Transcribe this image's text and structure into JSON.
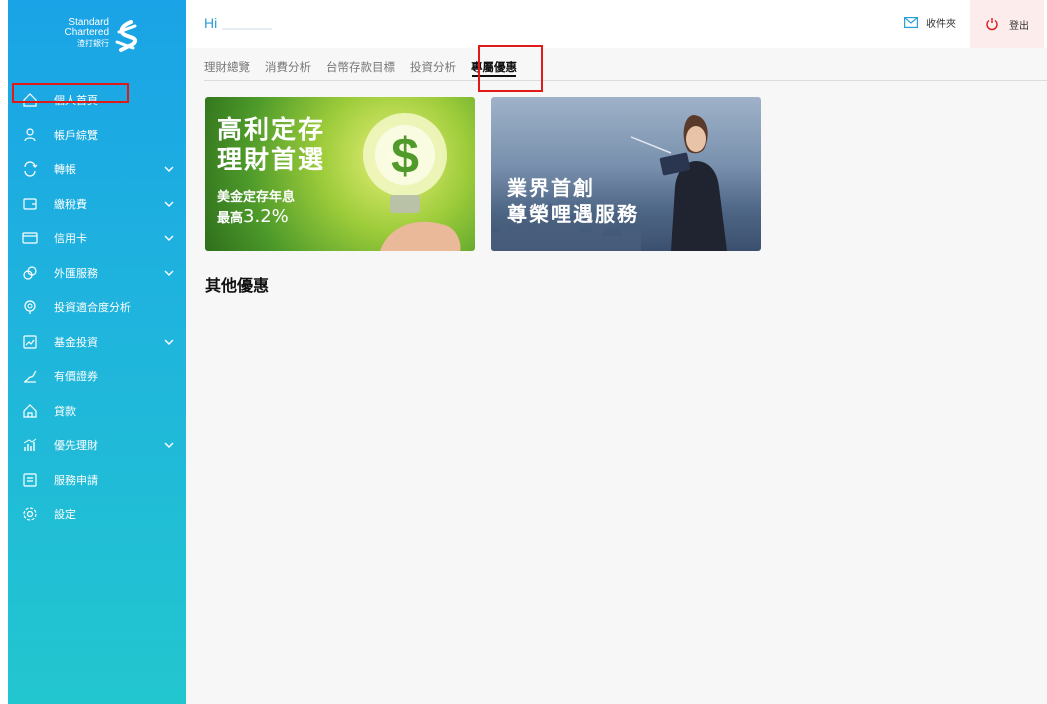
{
  "sidebar": {
    "logo": {
      "line1": "Standard",
      "line2": "Chartered",
      "line3": "渣打銀行"
    },
    "items": [
      {
        "label": "個人首頁",
        "icon": "home-icon",
        "has_chevron": false
      },
      {
        "label": "帳戶綜覽",
        "icon": "user-icon",
        "has_chevron": false
      },
      {
        "label": "轉帳",
        "icon": "transfer-icon",
        "has_chevron": true
      },
      {
        "label": "繳稅費",
        "icon": "bill-icon",
        "has_chevron": true
      },
      {
        "label": "信用卡",
        "icon": "card-icon",
        "has_chevron": true
      },
      {
        "label": "外匯服務",
        "icon": "fx-icon",
        "has_chevron": true
      },
      {
        "label": "投資適合度分析",
        "icon": "suitability-icon",
        "has_chevron": false
      },
      {
        "label": "基金投資",
        "icon": "fund-icon",
        "has_chevron": true
      },
      {
        "label": "有價證券",
        "icon": "securities-icon",
        "has_chevron": false
      },
      {
        "label": "貸款",
        "icon": "loan-icon",
        "has_chevron": false
      },
      {
        "label": "優先理財",
        "icon": "priority-icon",
        "has_chevron": true
      },
      {
        "label": "服務申請",
        "icon": "service-icon",
        "has_chevron": false
      },
      {
        "label": "設定",
        "icon": "settings-icon",
        "has_chevron": false
      }
    ]
  },
  "header": {
    "greeting": "Hi",
    "inbox_label": "收件夾",
    "logout_label": "登出"
  },
  "tabs": [
    {
      "label": "理財總覽",
      "active": false
    },
    {
      "label": "消費分析",
      "active": false
    },
    {
      "label": "台幣存款目標",
      "active": false
    },
    {
      "label": "投資分析",
      "active": false
    },
    {
      "label": "專屬優惠",
      "active": true
    }
  ],
  "banners": {
    "banner1": {
      "title_line1": "高利定存",
      "title_line2": "理財首選",
      "sub_line1": "美金定存年息",
      "sub_line2_prefix": "最高",
      "sub_line2_value": "3.2%"
    },
    "banner2": {
      "title_line1": "業界首創",
      "title_line2": "尊榮哩遇服務"
    }
  },
  "section": {
    "other_offers": "其他優惠"
  },
  "colors": {
    "sidebar_top": "#1aa3e6",
    "sidebar_bottom": "#22c6cf",
    "highlight_box": "#e01919",
    "greeting": "#2a9fd8",
    "logout_bg": "#fdecec"
  }
}
